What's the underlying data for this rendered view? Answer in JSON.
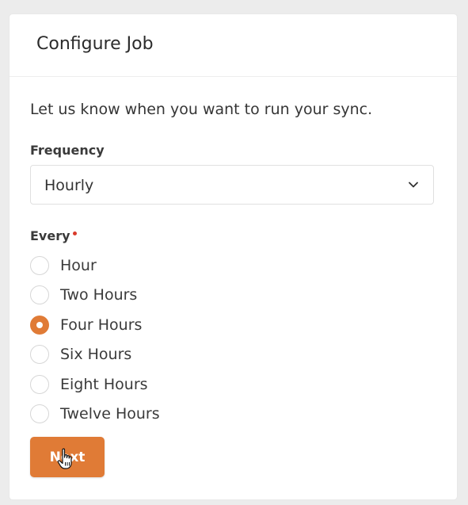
{
  "card": {
    "title": "Configure Job"
  },
  "intro": "Let us know when you want to run your sync.",
  "frequency": {
    "label": "Frequency",
    "selected": "Hourly"
  },
  "every": {
    "label": "Every",
    "required": true,
    "options": [
      {
        "label": "Hour",
        "checked": false
      },
      {
        "label": "Two Hours",
        "checked": false
      },
      {
        "label": "Four Hours",
        "checked": true
      },
      {
        "label": "Six Hours",
        "checked": false
      },
      {
        "label": "Eight Hours",
        "checked": false
      },
      {
        "label": "Twelve Hours",
        "checked": false
      }
    ]
  },
  "next_button": {
    "label": "Next"
  },
  "colors": {
    "accent": "#e07b36",
    "required": "#d93b2b"
  },
  "icons": {
    "select": "chevron-down-icon",
    "cursor": "hand-pointer-cursor"
  }
}
